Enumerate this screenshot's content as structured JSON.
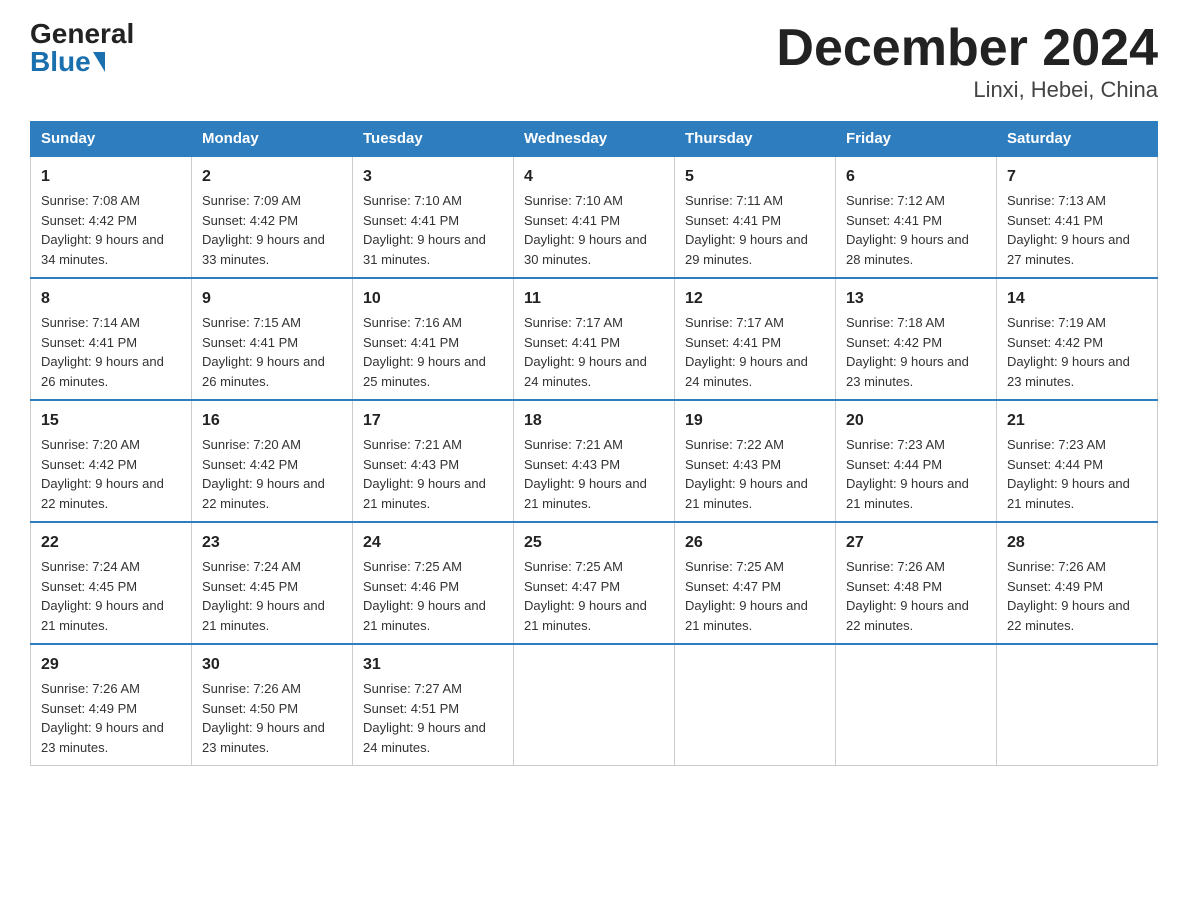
{
  "header": {
    "logo_general": "General",
    "logo_blue": "Blue",
    "title": "December 2024",
    "subtitle": "Linxi, Hebei, China"
  },
  "columns": [
    "Sunday",
    "Monday",
    "Tuesday",
    "Wednesday",
    "Thursday",
    "Friday",
    "Saturday"
  ],
  "weeks": [
    [
      {
        "day": "1",
        "sunrise": "Sunrise: 7:08 AM",
        "sunset": "Sunset: 4:42 PM",
        "daylight": "Daylight: 9 hours and 34 minutes."
      },
      {
        "day": "2",
        "sunrise": "Sunrise: 7:09 AM",
        "sunset": "Sunset: 4:42 PM",
        "daylight": "Daylight: 9 hours and 33 minutes."
      },
      {
        "day": "3",
        "sunrise": "Sunrise: 7:10 AM",
        "sunset": "Sunset: 4:41 PM",
        "daylight": "Daylight: 9 hours and 31 minutes."
      },
      {
        "day": "4",
        "sunrise": "Sunrise: 7:10 AM",
        "sunset": "Sunset: 4:41 PM",
        "daylight": "Daylight: 9 hours and 30 minutes."
      },
      {
        "day": "5",
        "sunrise": "Sunrise: 7:11 AM",
        "sunset": "Sunset: 4:41 PM",
        "daylight": "Daylight: 9 hours and 29 minutes."
      },
      {
        "day": "6",
        "sunrise": "Sunrise: 7:12 AM",
        "sunset": "Sunset: 4:41 PM",
        "daylight": "Daylight: 9 hours and 28 minutes."
      },
      {
        "day": "7",
        "sunrise": "Sunrise: 7:13 AM",
        "sunset": "Sunset: 4:41 PM",
        "daylight": "Daylight: 9 hours and 27 minutes."
      }
    ],
    [
      {
        "day": "8",
        "sunrise": "Sunrise: 7:14 AM",
        "sunset": "Sunset: 4:41 PM",
        "daylight": "Daylight: 9 hours and 26 minutes."
      },
      {
        "day": "9",
        "sunrise": "Sunrise: 7:15 AM",
        "sunset": "Sunset: 4:41 PM",
        "daylight": "Daylight: 9 hours and 26 minutes."
      },
      {
        "day": "10",
        "sunrise": "Sunrise: 7:16 AM",
        "sunset": "Sunset: 4:41 PM",
        "daylight": "Daylight: 9 hours and 25 minutes."
      },
      {
        "day": "11",
        "sunrise": "Sunrise: 7:17 AM",
        "sunset": "Sunset: 4:41 PM",
        "daylight": "Daylight: 9 hours and 24 minutes."
      },
      {
        "day": "12",
        "sunrise": "Sunrise: 7:17 AM",
        "sunset": "Sunset: 4:41 PM",
        "daylight": "Daylight: 9 hours and 24 minutes."
      },
      {
        "day": "13",
        "sunrise": "Sunrise: 7:18 AM",
        "sunset": "Sunset: 4:42 PM",
        "daylight": "Daylight: 9 hours and 23 minutes."
      },
      {
        "day": "14",
        "sunrise": "Sunrise: 7:19 AM",
        "sunset": "Sunset: 4:42 PM",
        "daylight": "Daylight: 9 hours and 23 minutes."
      }
    ],
    [
      {
        "day": "15",
        "sunrise": "Sunrise: 7:20 AM",
        "sunset": "Sunset: 4:42 PM",
        "daylight": "Daylight: 9 hours and 22 minutes."
      },
      {
        "day": "16",
        "sunrise": "Sunrise: 7:20 AM",
        "sunset": "Sunset: 4:42 PM",
        "daylight": "Daylight: 9 hours and 22 minutes."
      },
      {
        "day": "17",
        "sunrise": "Sunrise: 7:21 AM",
        "sunset": "Sunset: 4:43 PM",
        "daylight": "Daylight: 9 hours and 21 minutes."
      },
      {
        "day": "18",
        "sunrise": "Sunrise: 7:21 AM",
        "sunset": "Sunset: 4:43 PM",
        "daylight": "Daylight: 9 hours and 21 minutes."
      },
      {
        "day": "19",
        "sunrise": "Sunrise: 7:22 AM",
        "sunset": "Sunset: 4:43 PM",
        "daylight": "Daylight: 9 hours and 21 minutes."
      },
      {
        "day": "20",
        "sunrise": "Sunrise: 7:23 AM",
        "sunset": "Sunset: 4:44 PM",
        "daylight": "Daylight: 9 hours and 21 minutes."
      },
      {
        "day": "21",
        "sunrise": "Sunrise: 7:23 AM",
        "sunset": "Sunset: 4:44 PM",
        "daylight": "Daylight: 9 hours and 21 minutes."
      }
    ],
    [
      {
        "day": "22",
        "sunrise": "Sunrise: 7:24 AM",
        "sunset": "Sunset: 4:45 PM",
        "daylight": "Daylight: 9 hours and 21 minutes."
      },
      {
        "day": "23",
        "sunrise": "Sunrise: 7:24 AM",
        "sunset": "Sunset: 4:45 PM",
        "daylight": "Daylight: 9 hours and 21 minutes."
      },
      {
        "day": "24",
        "sunrise": "Sunrise: 7:25 AM",
        "sunset": "Sunset: 4:46 PM",
        "daylight": "Daylight: 9 hours and 21 minutes."
      },
      {
        "day": "25",
        "sunrise": "Sunrise: 7:25 AM",
        "sunset": "Sunset: 4:47 PM",
        "daylight": "Daylight: 9 hours and 21 minutes."
      },
      {
        "day": "26",
        "sunrise": "Sunrise: 7:25 AM",
        "sunset": "Sunset: 4:47 PM",
        "daylight": "Daylight: 9 hours and 21 minutes."
      },
      {
        "day": "27",
        "sunrise": "Sunrise: 7:26 AM",
        "sunset": "Sunset: 4:48 PM",
        "daylight": "Daylight: 9 hours and 22 minutes."
      },
      {
        "day": "28",
        "sunrise": "Sunrise: 7:26 AM",
        "sunset": "Sunset: 4:49 PM",
        "daylight": "Daylight: 9 hours and 22 minutes."
      }
    ],
    [
      {
        "day": "29",
        "sunrise": "Sunrise: 7:26 AM",
        "sunset": "Sunset: 4:49 PM",
        "daylight": "Daylight: 9 hours and 23 minutes."
      },
      {
        "day": "30",
        "sunrise": "Sunrise: 7:26 AM",
        "sunset": "Sunset: 4:50 PM",
        "daylight": "Daylight: 9 hours and 23 minutes."
      },
      {
        "day": "31",
        "sunrise": "Sunrise: 7:27 AM",
        "sunset": "Sunset: 4:51 PM",
        "daylight": "Daylight: 9 hours and 24 minutes."
      },
      null,
      null,
      null,
      null
    ]
  ]
}
